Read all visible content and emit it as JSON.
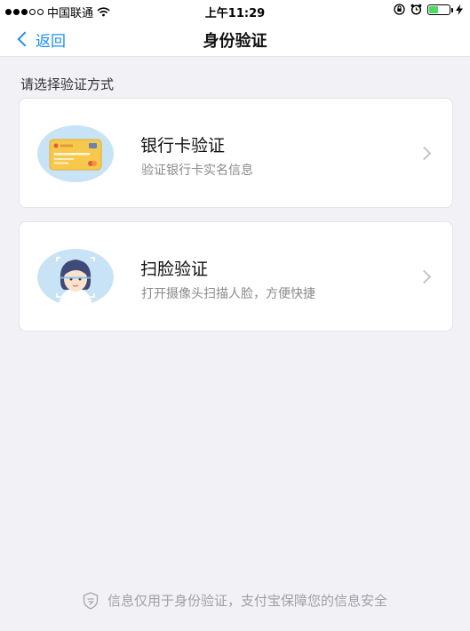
{
  "status_bar": {
    "carrier": "中国联通",
    "time": "上午11:29",
    "battery_level": 0.45
  },
  "nav": {
    "back_label": "返回",
    "title": "身份验证"
  },
  "section_label": "请选择验证方式",
  "options": [
    {
      "title": "银行卡验证",
      "subtitle": "验证银行卡实名信息",
      "icon": "bank-card-icon"
    },
    {
      "title": "扫脸验证",
      "subtitle": "打开摄像头扫描人脸，方便快捷",
      "icon": "face-scan-icon"
    }
  ],
  "footer": {
    "text": "信息仅用于身份验证，支付宝保障您的信息安全",
    "icon": "shield-icon"
  },
  "colors": {
    "accent": "#1e8ff0",
    "background": "#f1f1f6",
    "card_background": "#ffffff",
    "subtitle": "#8a8a8f"
  }
}
